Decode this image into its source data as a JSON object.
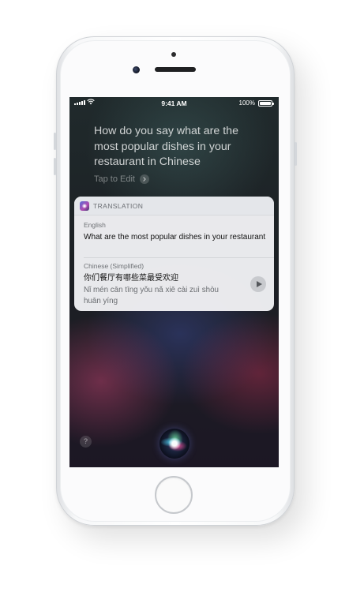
{
  "status_bar": {
    "time": "9:41 AM",
    "battery": "100%"
  },
  "siri": {
    "query": "How do you say what are the most popular dishes in your restaurant in Chinese",
    "tap_to_edit": "Tap to Edit"
  },
  "translation_card": {
    "header": "TRANSLATION",
    "source": {
      "language": "English",
      "text": "What are the most popular dishes in your restaurant"
    },
    "target": {
      "language": "Chinese (Simplified)",
      "text": "你们餐厅有哪些菜最受欢迎",
      "pinyin": "Nǐ mén cān tīng yǒu nǎ xiē cài zuì shòu huān yíng"
    }
  },
  "help_label": "?",
  "icons": {
    "app": "translation-app-icon",
    "play": "play-icon",
    "chevron": "chevron-right-icon",
    "signal": "cellular-signal-icon",
    "wifi": "wifi-icon",
    "battery": "battery-icon",
    "siri": "siri-orb-icon"
  }
}
